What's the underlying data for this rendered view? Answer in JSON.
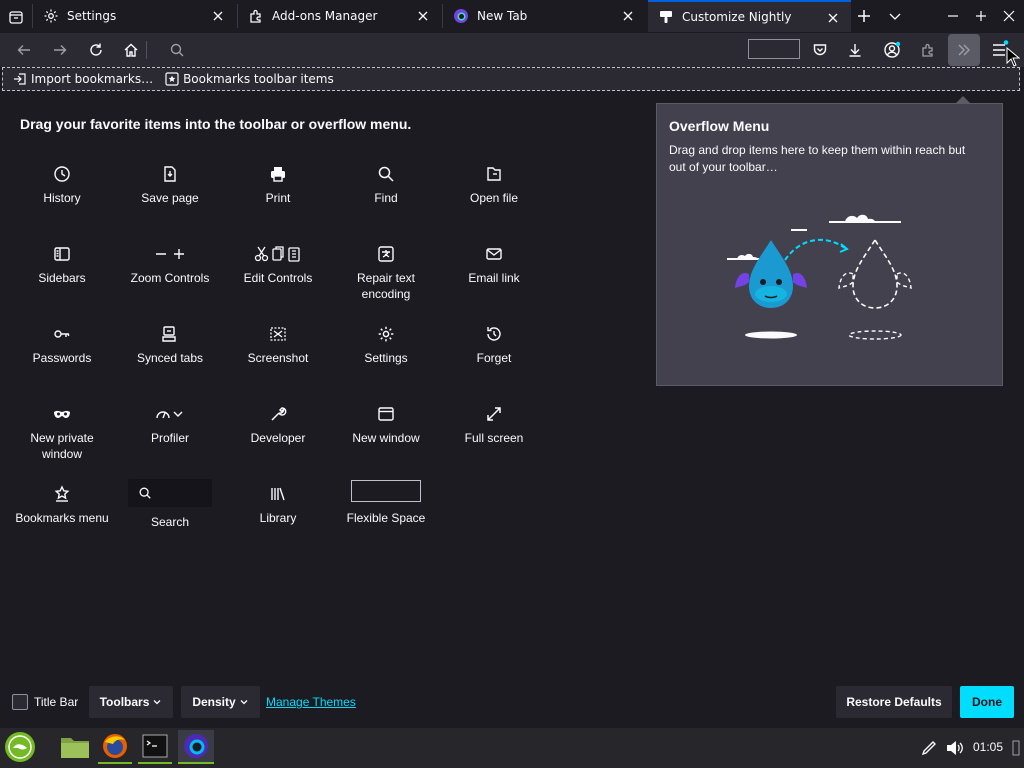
{
  "tabs": [
    {
      "label": "Settings",
      "icon": "gear-icon"
    },
    {
      "label": "Add-ons Manager",
      "icon": "puzzle-icon"
    },
    {
      "label": "New Tab",
      "icon": "firefox-icon"
    },
    {
      "label": "Customize Nightly",
      "icon": "paintbrush-icon",
      "selected": true
    }
  ],
  "bookmarks": {
    "import_label": "Import bookmarks…",
    "toolbar_items_label": "Bookmarks toolbar items"
  },
  "palette": {
    "heading": "Drag your favorite items into the toolbar or overflow menu.",
    "items": [
      {
        "label": "History",
        "icon": "clock-icon"
      },
      {
        "label": "Save page",
        "icon": "save-page-icon"
      },
      {
        "label": "Print",
        "icon": "printer-icon"
      },
      {
        "label": "Find",
        "icon": "search-icon"
      },
      {
        "label": "Open file",
        "icon": "open-file-icon"
      },
      {
        "label": "Sidebars",
        "icon": "sidebar-icon"
      },
      {
        "label": "Zoom Controls",
        "icon": "zoom-icon"
      },
      {
        "label": "Edit Controls",
        "icon": "edit-controls-icon"
      },
      {
        "label": "Repair text encoding",
        "icon": "text-encoding-icon"
      },
      {
        "label": "Email link",
        "icon": "mail-icon"
      },
      {
        "label": "Passwords",
        "icon": "key-icon"
      },
      {
        "label": "Synced tabs",
        "icon": "synced-tabs-icon"
      },
      {
        "label": "Screenshot",
        "icon": "screenshot-icon"
      },
      {
        "label": "Settings",
        "icon": "gear-icon"
      },
      {
        "label": "Forget",
        "icon": "forget-icon"
      },
      {
        "label": "New private window",
        "icon": "mask-icon"
      },
      {
        "label": "Profiler",
        "icon": "profiler-icon"
      },
      {
        "label": "Developer",
        "icon": "wrench-icon"
      },
      {
        "label": "New window",
        "icon": "window-icon"
      },
      {
        "label": "Full screen",
        "icon": "fullscreen-icon"
      },
      {
        "label": "Bookmarks menu",
        "icon": "bookmarks-menu-icon"
      },
      {
        "label": "Search",
        "icon": "search-icon"
      },
      {
        "label": "Library",
        "icon": "library-icon"
      },
      {
        "label": "Flexible Space",
        "icon": "flexible-space-icon"
      }
    ]
  },
  "overflow": {
    "title": "Overflow Menu",
    "description": "Drag and drop items here to keep them within reach but out of your toolbar…"
  },
  "footer": {
    "title_bar_label": "Title Bar",
    "toolbars_label": "Toolbars",
    "density_label": "Density",
    "manage_themes_label": "Manage Themes",
    "restore_label": "Restore Defaults",
    "done_label": "Done"
  },
  "taskbar": {
    "clock": "01:05"
  },
  "colors": {
    "accent": "#00ddff",
    "link": "#00ddff",
    "tab_selected_border": "#0060df",
    "panel": "#42414d"
  }
}
